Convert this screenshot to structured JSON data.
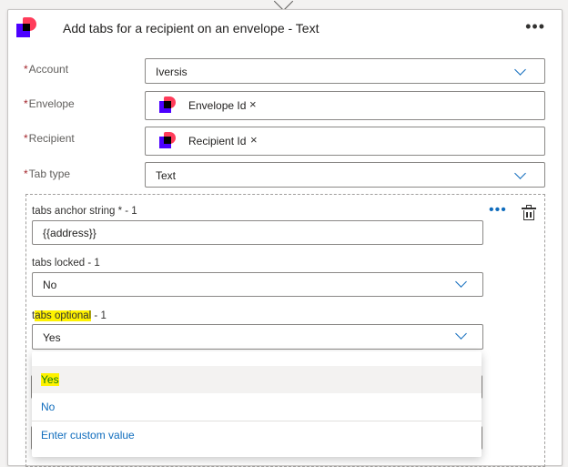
{
  "card": {
    "title": "Add tabs for a recipient on an envelope - Text",
    "more": "•••"
  },
  "fields": {
    "account": {
      "label": "Account",
      "value": "Iversis"
    },
    "envelope": {
      "label": "Envelope",
      "token": "Envelope Id",
      "remove": "×"
    },
    "recipient": {
      "label": "Recipient",
      "token": "Recipient Id",
      "remove": "×"
    },
    "tab_type": {
      "label": "Tab type",
      "value": "Text"
    },
    "required_mark": "*"
  },
  "tab_item": {
    "more": "•••",
    "anchor": {
      "label": "tabs anchor string * - 1",
      "value": "{{address}}"
    },
    "locked": {
      "label": "tabs locked - 1",
      "value": "No"
    },
    "optional": {
      "label_prefix": "t",
      "label_highlight": "abs optional",
      "label_suffix": " - 1",
      "value": "Yes"
    }
  },
  "dropdown": {
    "options": [
      "Yes",
      "No"
    ],
    "custom": "Enter custom value",
    "selected": "Yes"
  },
  "colors": {
    "accent": "#0f6cbd",
    "highlight": "#fff200",
    "brand_red": "#ff3c5a",
    "brand_purple": "#4c00ff"
  },
  "icons": {
    "logo": "docusign-logo",
    "delete": "trash-icon",
    "chevron": "chevron-down-icon"
  }
}
